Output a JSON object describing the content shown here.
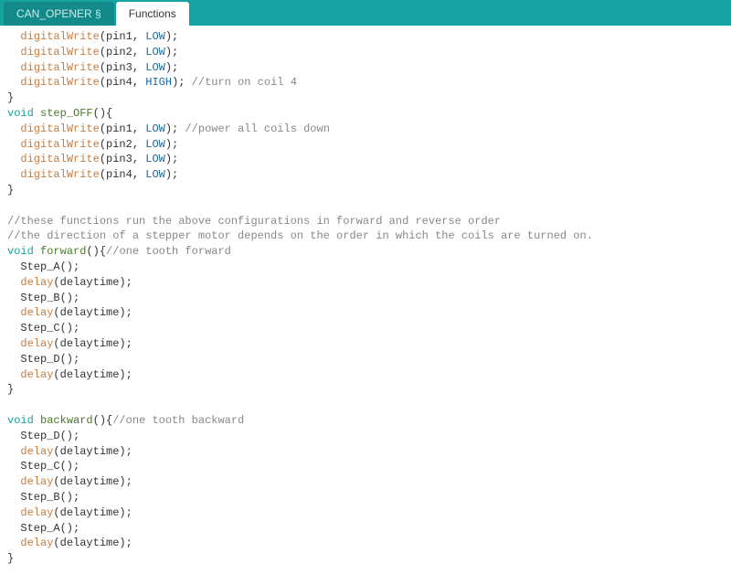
{
  "tabs": {
    "inactive": "CAN_OPENER §",
    "active": "Functions"
  },
  "code": {
    "l01a": "digitalWrite",
    "l01b": "(pin1, ",
    "l01c": "LOW",
    "l01d": ");",
    "l02a": "digitalWrite",
    "l02b": "(pin2, ",
    "l02c": "LOW",
    "l02d": ");",
    "l03a": "digitalWrite",
    "l03b": "(pin3, ",
    "l03c": "LOW",
    "l03d": ");",
    "l04a": "digitalWrite",
    "l04b": "(pin4, ",
    "l04c": "HIGH",
    "l04d": "); ",
    "l04e": "//turn on coil 4",
    "l05": "}",
    "l06a": "void",
    "l06b": " ",
    "l06c": "step_OFF",
    "l06d": "(){",
    "l07a": "digitalWrite",
    "l07b": "(pin1, ",
    "l07c": "LOW",
    "l07d": "); ",
    "l07e": "//power all coils down",
    "l08a": "digitalWrite",
    "l08b": "(pin2, ",
    "l08c": "LOW",
    "l08d": ");",
    "l09a": "digitalWrite",
    "l09b": "(pin3, ",
    "l09c": "LOW",
    "l09d": ");",
    "l10a": "digitalWrite",
    "l10b": "(pin4, ",
    "l10c": "LOW",
    "l10d": ");",
    "l11": "}",
    "blank1": "",
    "l12": "//these functions run the above configurations in forward and reverse order",
    "l13": "//the direction of a stepper motor depends on the order in which the coils are turned on.",
    "l14a": "void",
    "l14b": " ",
    "l14c": "forward",
    "l14d": "(){",
    "l14e": "//one tooth forward",
    "l15": "  Step_A();",
    "l16a": "delay",
    "l16b": "(delaytime);",
    "l17": "  Step_B();",
    "l18a": "delay",
    "l18b": "(delaytime);",
    "l19": "  Step_C();",
    "l20a": "delay",
    "l20b": "(delaytime);",
    "l21": "  Step_D();",
    "l22a": "delay",
    "l22b": "(delaytime);",
    "l23": "}",
    "blank2": "",
    "l24a": "void",
    "l24b": " ",
    "l24c": "backward",
    "l24d": "(){",
    "l24e": "//one tooth backward",
    "l25": "  Step_D();",
    "l26a": "delay",
    "l26b": "(delaytime);",
    "l27": "  Step_C();",
    "l28a": "delay",
    "l28b": "(delaytime);",
    "l29": "  Step_B();",
    "l30a": "delay",
    "l30b": "(delaytime);",
    "l31": "  Step_A();",
    "l32a": "delay",
    "l32b": "(delaytime);",
    "l33": "}"
  }
}
